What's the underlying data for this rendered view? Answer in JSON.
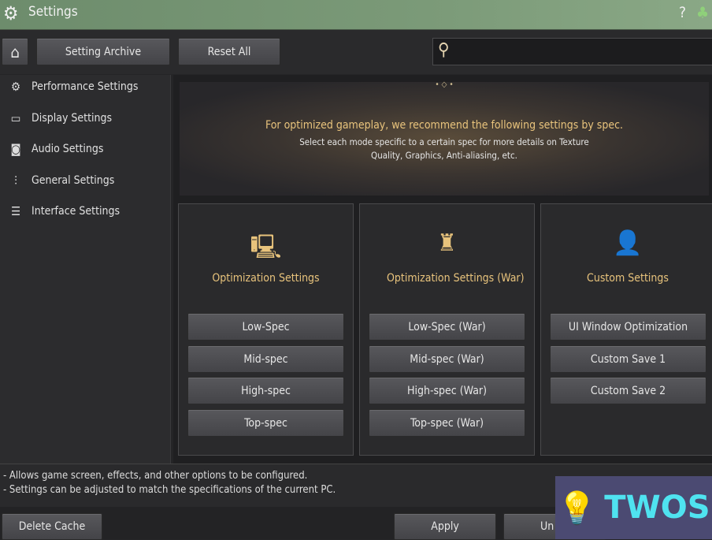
{
  "window": {
    "title": "Settings",
    "help": "?"
  },
  "toolbar": {
    "setting_archive": "Setting Archive",
    "reset_all": "Reset All",
    "search_placeholder": ""
  },
  "sidebar": {
    "items": [
      {
        "label": "Performance Settings",
        "icon": "gears-icon"
      },
      {
        "label": "Display Settings",
        "icon": "monitor-icon"
      },
      {
        "label": "Audio Settings",
        "icon": "speaker-icon"
      },
      {
        "label": "General Settings",
        "icon": "sliders-icon"
      },
      {
        "label": "Interface Settings",
        "icon": "list-icon"
      }
    ]
  },
  "banner": {
    "headline": "For optimized gameplay, we recommend the following settings by spec.",
    "sub1": "Select each mode specific to a certain spec for more details on Texture",
    "sub2": "Quality, Graphics, Anti-aliasing, etc."
  },
  "cards": [
    {
      "title": "Optimization Settings",
      "icon": "computer-icon",
      "buttons": [
        "Low-Spec",
        "Mid-spec",
        "High-spec",
        "Top-spec"
      ]
    },
    {
      "title": "Optimization Settings (War)",
      "icon": "castle-tower-icon",
      "buttons": [
        "Low-Spec (War)",
        "Mid-spec (War)",
        "High-spec (War)",
        "Top-spec (War)"
      ]
    },
    {
      "title": "Custom Settings",
      "icon": "user-icon",
      "buttons": [
        "UI Window Optimization",
        "Custom Save 1",
        "Custom Save 2"
      ]
    }
  ],
  "footer": {
    "line1": "- Allows game screen, effects, and other options to be configured.",
    "line2": "- Settings can be adjusted to match the specifications of the current PC."
  },
  "bottom": {
    "delete_cache": "Delete Cache",
    "apply": "Apply",
    "undo": "Un"
  },
  "watermark": {
    "text": "TWOS"
  },
  "colors": {
    "accent": "#e8c37c",
    "titlebar": "#6d8c6c",
    "watermark_text": "#4fe3f0"
  }
}
